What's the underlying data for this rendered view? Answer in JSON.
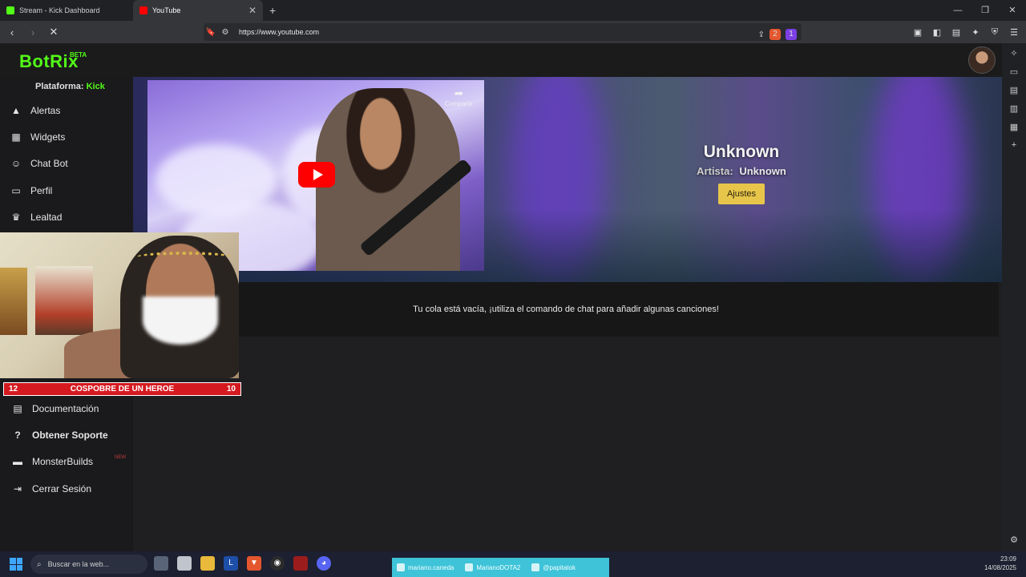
{
  "browser": {
    "tabs": [
      {
        "title": "Stream - Kick Dashboard",
        "active": false,
        "favicon_color": "#53fc18"
      },
      {
        "title": "YouTube",
        "active": true,
        "favicon_color": "#ff0000"
      }
    ],
    "new_tab": "+",
    "window_controls": {
      "minimize": "—",
      "restore": "❐",
      "close": "✕"
    },
    "url": "https://www.youtube.com",
    "brave_shield_count": "2",
    "rewards_count": "1"
  },
  "app": {
    "logo": "BotRix",
    "beta": "BETA",
    "platform_label": "Plataforma:",
    "platform_value": "Kick",
    "accent": "#53fc18"
  },
  "sidebar": {
    "items": [
      {
        "label": "Alertas",
        "icon": "warning-icon"
      },
      {
        "label": "Widgets",
        "icon": "grid-icon"
      },
      {
        "label": "Chat Bot",
        "icon": "robot-icon"
      },
      {
        "label": "Perfil",
        "icon": "id-card-icon"
      },
      {
        "label": "Lealtad",
        "icon": "trophy-icon"
      }
    ],
    "bottom_items": [
      {
        "label": "Documentación",
        "icon": "scroll-icon"
      },
      {
        "label": "Obtener Soporte",
        "icon": "question-icon"
      },
      {
        "label": "MonsterBuilds",
        "icon": "laptop-icon"
      },
      {
        "label": "Cerrar Sesión",
        "icon": "logout-icon"
      }
    ],
    "new_badge": "NEW"
  },
  "player": {
    "share_label": "Compartir",
    "title": "Unknown",
    "artist_label": "Artista:",
    "artist": "Unknown",
    "settings_button": "Ajustes",
    "settings_color": "#e7c54a"
  },
  "queue": {
    "empty_message": "Tu cola está vacía, ¡utiliza el comando de chat para añadir algunas canciones!"
  },
  "overlay": {
    "banner_left": "12",
    "banner_text": "COSPOBRE DE UN HEROE",
    "banner_right": "10",
    "banner_color": "#d41a20"
  },
  "taskbar": {
    "search_placeholder": "Buscar en la web...",
    "socials": [
      {
        "label": "mariano.caneda",
        "icon": "instagram-icon"
      },
      {
        "label": "MarianoDOTA2",
        "icon": "facebook-icon"
      },
      {
        "label": "@papitatok",
        "icon": "tiktok-icon"
      }
    ],
    "time": "23:09",
    "date": "14/08/2025"
  }
}
